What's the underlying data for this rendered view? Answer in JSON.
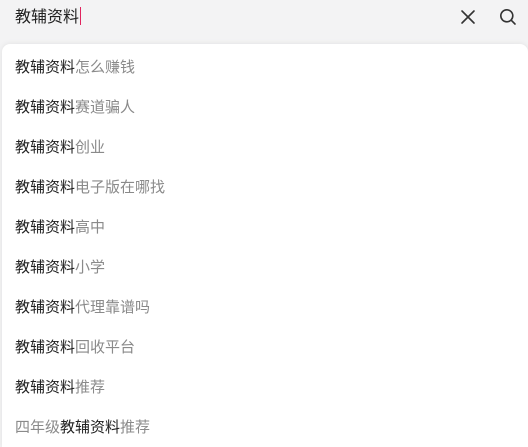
{
  "search": {
    "query": "教辅资料",
    "placeholder": ""
  },
  "icons": {
    "clear": "close-icon",
    "search": "search-icon"
  },
  "colors": {
    "caret": "#e0245e",
    "keyword": "#222222",
    "suggestion_rest": "#8a8a8a",
    "bar_background": "#f3f3f4"
  },
  "suggestions": [
    {
      "prefix": "",
      "keyword": "教辅资料",
      "suffix": "怎么赚钱"
    },
    {
      "prefix": "",
      "keyword": "教辅资料",
      "suffix": "赛道骗人"
    },
    {
      "prefix": "",
      "keyword": "教辅资料",
      "suffix": "创业"
    },
    {
      "prefix": "",
      "keyword": "教辅资料",
      "suffix": "电子版在哪找"
    },
    {
      "prefix": "",
      "keyword": "教辅资料",
      "suffix": "高中"
    },
    {
      "prefix": "",
      "keyword": "教辅资料",
      "suffix": "小学"
    },
    {
      "prefix": "",
      "keyword": "教辅资料",
      "suffix": "代理靠谱吗"
    },
    {
      "prefix": "",
      "keyword": "教辅资料",
      "suffix": "回收平台"
    },
    {
      "prefix": "",
      "keyword": "教辅资料",
      "suffix": "推荐"
    },
    {
      "prefix": "四年级",
      "keyword": "教辅资料",
      "suffix": "推荐"
    }
  ]
}
